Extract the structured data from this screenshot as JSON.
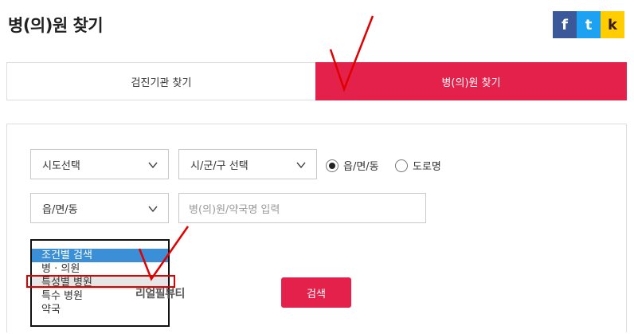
{
  "header": {
    "title": "병(의)원 찾기",
    "share": [
      {
        "label": "f",
        "icon": "facebook-icon",
        "color": "#3b5998"
      },
      {
        "label": "t",
        "icon": "twitter-icon",
        "color": "#1da1f2"
      },
      {
        "label": "k",
        "icon": "kakaostory-icon",
        "color": "#ffcd00"
      }
    ]
  },
  "tabs": [
    {
      "label": "검진기관 찾기",
      "active": false
    },
    {
      "label": "병(의)원 찾기",
      "active": true
    }
  ],
  "form": {
    "sido_select": "시도선택",
    "sigungu_select": "시/군/구 선택",
    "eup_select": "읍/면/동",
    "radio_options": [
      {
        "label": "읍/면/동",
        "checked": true
      },
      {
        "label": "도로명",
        "checked": false
      }
    ],
    "name_input_placeholder": "병(의)원/약국명 입력",
    "category_options": [
      "조건별 검색",
      "병 · 의원",
      "특성별 병원",
      "특수 병원",
      "약국"
    ],
    "category_selected_index": 0,
    "category_highlighted_index": 2,
    "search_button": "검색"
  },
  "watermark": "리얼필뷰티",
  "colors": {
    "accent": "#e4214b",
    "selected_option": "#3a8fd6",
    "annotation": "#e00000"
  }
}
